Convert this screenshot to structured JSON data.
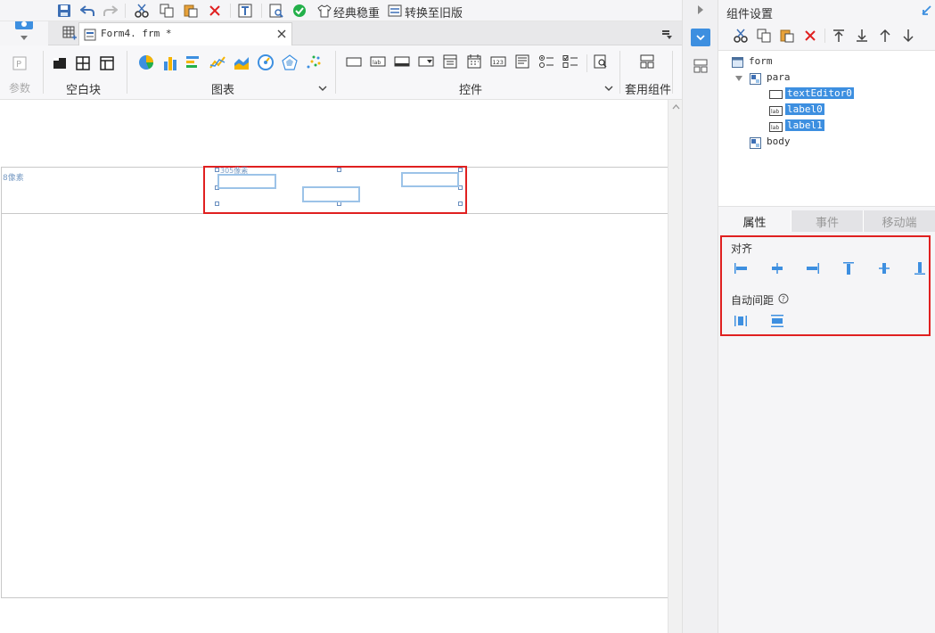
{
  "toolbar": {
    "classic_label": "经典稳重",
    "convert_label": "转换至旧版"
  },
  "tab": {
    "filename": "Form4. frm *"
  },
  "ribbon": {
    "param_label": "参数",
    "blank_label": "空白块",
    "chart_label": "图表",
    "control_label": "控件",
    "template_label": "套用组件"
  },
  "canvas": {
    "left_caption": "8像素",
    "para_caption": "305像素"
  },
  "right_panel": {
    "title": "组件设置",
    "tree": [
      {
        "label": "form",
        "level": 0
      },
      {
        "label": "para",
        "level": 1
      },
      {
        "label": "textEditor0",
        "level": 2,
        "selected": true
      },
      {
        "label": "label0",
        "level": 2,
        "selected": true
      },
      {
        "label": "label1",
        "level": 2,
        "selected": true
      },
      {
        "label": "body",
        "level": 1
      }
    ],
    "tabs": [
      "属性",
      "事件",
      "移动端"
    ],
    "align_title": "对齐",
    "spacing_title": "自动间距"
  },
  "colors": {
    "accent": "#3d8fe0",
    "highlight_border": "#e02020",
    "widget_border": "#9cc3e8"
  }
}
